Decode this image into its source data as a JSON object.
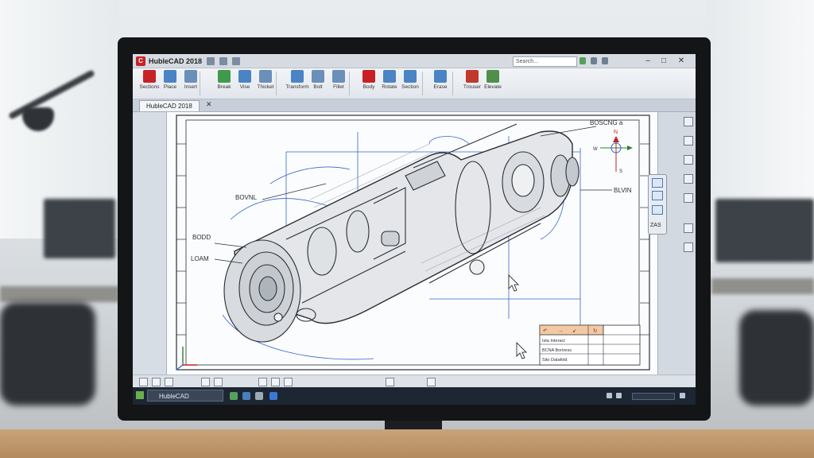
{
  "window": {
    "title": "HubleCAD 2018",
    "search_placeholder": "Search...",
    "controls": [
      "–",
      "□",
      "✕"
    ]
  },
  "ribbon": {
    "groups": [
      {
        "label": "Sections",
        "color": "#c82027"
      },
      {
        "label": "Place",
        "color": "#4a84c4"
      },
      {
        "label": "Insert",
        "color": "#6a8fb8"
      },
      {
        "label": "Break",
        "color": "#3f9b4b"
      },
      {
        "label": "Vise",
        "color": "#4a84c4"
      },
      {
        "label": "Thicket",
        "color": "#6a8fb8"
      },
      {
        "label": "Transform",
        "color": "#4a84c4"
      },
      {
        "label": "Bolt",
        "color": "#6a8fb8"
      },
      {
        "label": "Fillet",
        "color": "#6a8fb8"
      },
      {
        "label": "Body",
        "color": "#c82027"
      },
      {
        "label": "Rotate",
        "color": "#4a84c4"
      },
      {
        "label": "Section",
        "color": "#4a84c4"
      },
      {
        "label": "Erase",
        "color": "#4a84c4"
      },
      {
        "label": "Trouser",
        "color": "#c0392b"
      },
      {
        "label": "Elevate",
        "color": "#4f8f4a"
      }
    ]
  },
  "document": {
    "tab_label": "HubleCAD 2018"
  },
  "drawing": {
    "callouts": {
      "top": "BOSCNG a",
      "right": "BLVIN",
      "left1": "BOVNL",
      "left2": "BODD",
      "left3": "LOAM"
    },
    "compass": {
      "north": "N",
      "west": "W",
      "south": "S"
    },
    "title_block": {
      "header": [
        "↶",
        "→",
        "↙",
        "↻"
      ],
      "rows": [
        "Ista Interact",
        "BCNA Bortress",
        "Sito Datafold"
      ]
    }
  },
  "navigation": {
    "label": "ZAS"
  },
  "taskbar": {
    "app_label": "HubleCAD"
  },
  "colors": {
    "accent": "#c82027",
    "drawing_line": "#2a2f36",
    "construction_line": "#3566c8"
  }
}
